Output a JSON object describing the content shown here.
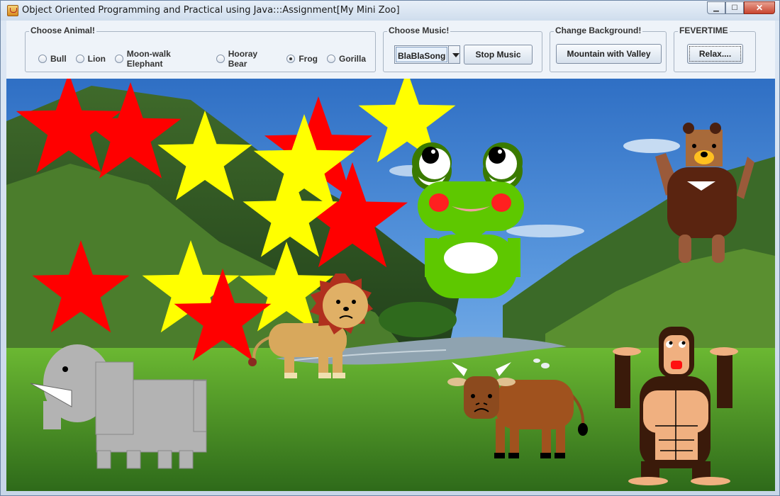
{
  "window": {
    "title": "Object Oriented Programming and Practical using Java:::Assignment[My Mini Zoo]",
    "controls": {
      "minimize": "▁",
      "maximize": "☐",
      "close": "✕"
    }
  },
  "choose_animal": {
    "title": "Choose Animal!",
    "options": [
      "Bull",
      "Lion",
      "Moon-walk Elephant",
      "Hooray Bear",
      "Frog",
      "Gorilla"
    ],
    "selected": "Frog"
  },
  "choose_music": {
    "title": "Choose Music!",
    "selected_song": "BlaBlaSong",
    "stop_label": "Stop Music"
  },
  "change_background": {
    "title": "Change Background!",
    "button_label": "Mountain with Valley"
  },
  "fevertime": {
    "title": "FEVERTIME",
    "button_label": "Relax...."
  },
  "scene": {
    "background": "Mountain with Valley",
    "animals": [
      "Frog",
      "Hooray Bear",
      "Lion",
      "Moon-walk Elephant",
      "Bull",
      "Gorilla"
    ],
    "star_colors": [
      "#ff0000",
      "#ffff00"
    ],
    "colors": {
      "sky": "#3f7fd0",
      "grass": "#57a02a",
      "river": "#8fa3b0"
    }
  }
}
